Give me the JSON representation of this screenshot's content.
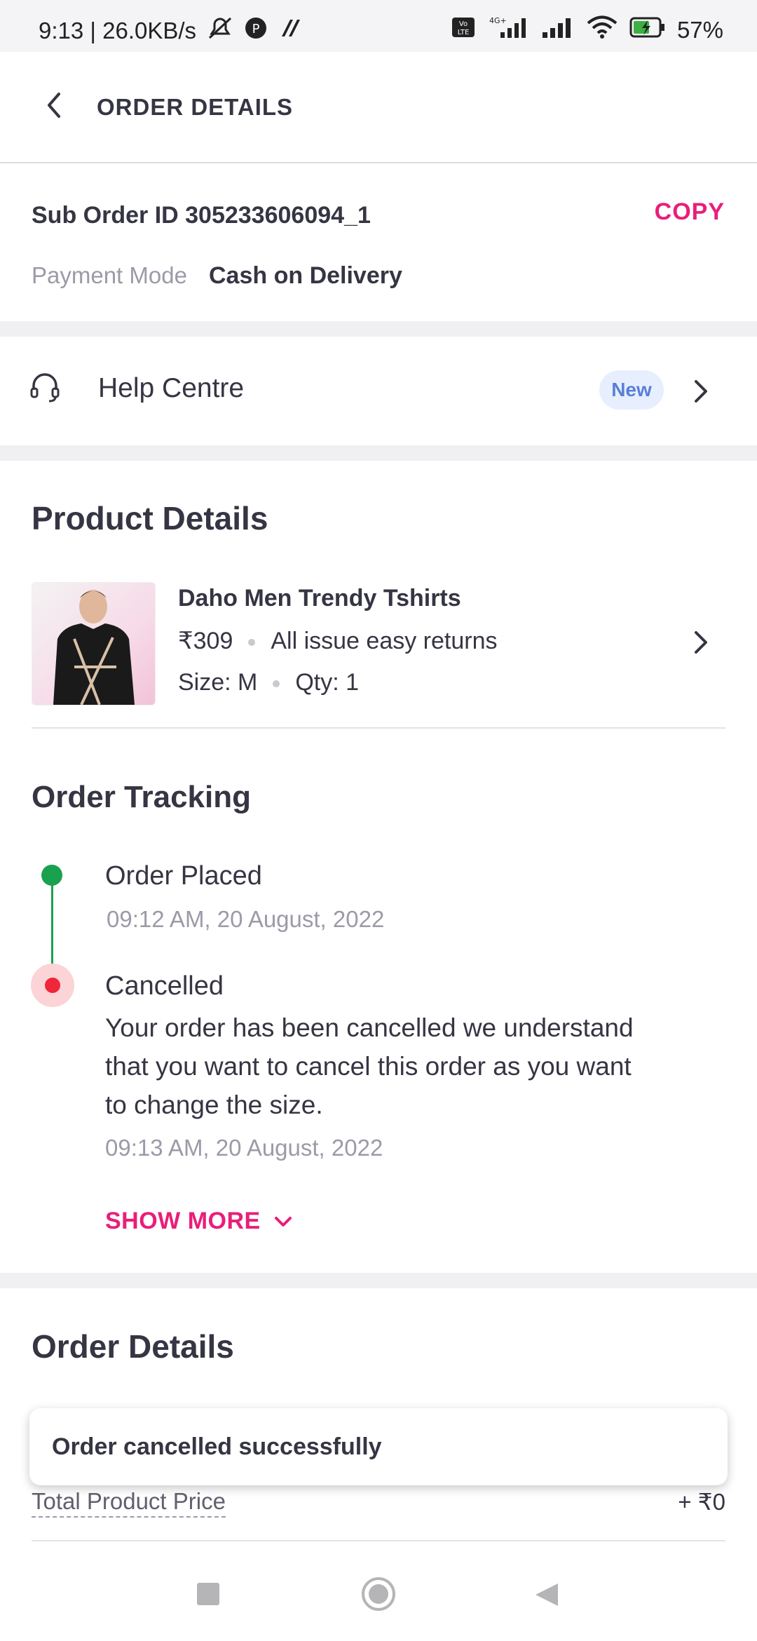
{
  "status_bar": {
    "time_speed": "9:13 | 26.0KB/s",
    "network": "4G+",
    "battery": "57%"
  },
  "header": {
    "title": "ORDER DETAILS"
  },
  "sub_order": {
    "label": "Sub Order ID 305233606094_1",
    "copy_label": "COPY",
    "payment_mode_label": "Payment Mode",
    "payment_mode_value": "Cash on Delivery"
  },
  "help": {
    "label": "Help Centre",
    "badge": "New"
  },
  "product_details": {
    "heading": "Product Details",
    "name": "Daho Men Trendy Tshirts",
    "price": "₹309",
    "returns": "All issue easy returns",
    "size": "Size: M",
    "qty": "Qty: 1"
  },
  "tracking": {
    "heading": "Order Tracking",
    "steps": [
      {
        "title": "Order Placed",
        "time": "09:12 AM, 20 August, 2022"
      },
      {
        "title": "Cancelled",
        "description": "Your order has been cancelled we understand that you want to cancel this order as you want to change the size.",
        "time": "09:13 AM, 20 August, 2022"
      }
    ],
    "show_more": "SHOW MORE"
  },
  "order_details": {
    "heading": "Order Details",
    "total_label": "Total Product Price",
    "total_value": "+  ₹0"
  },
  "toast": {
    "message": "Order cancelled successfully"
  },
  "colors": {
    "accent": "#e91e7a",
    "placed": "#1aa14f",
    "cancelled": "#f0263a"
  }
}
